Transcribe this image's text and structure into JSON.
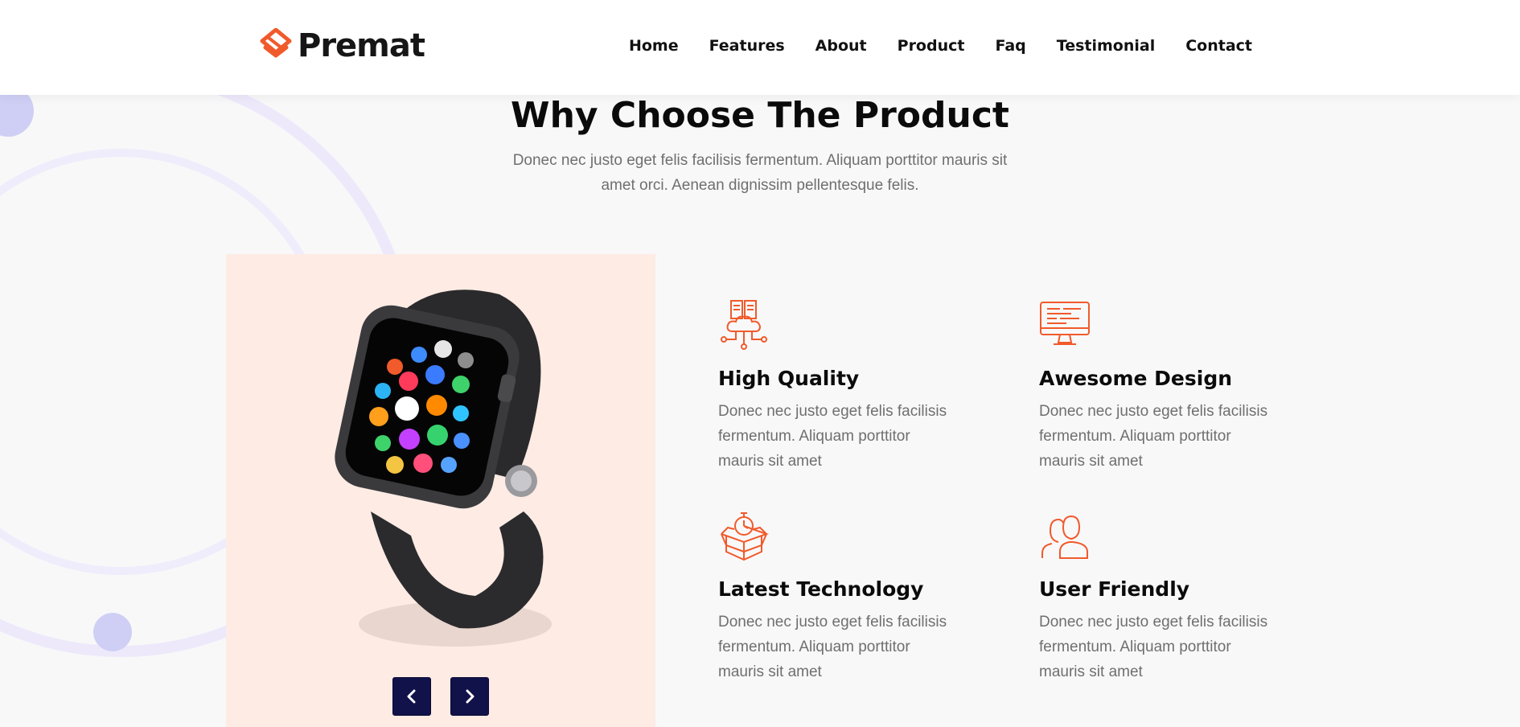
{
  "brand": {
    "name": "Premat",
    "accent": "#f15a2b"
  },
  "nav": {
    "items": [
      {
        "label": "Home"
      },
      {
        "label": "Features"
      },
      {
        "label": "About"
      },
      {
        "label": "Product"
      },
      {
        "label": "Faq"
      },
      {
        "label": "Testimonial"
      },
      {
        "label": "Contact"
      }
    ]
  },
  "section": {
    "title": "Why Choose The Product",
    "subtitle": "Donec nec justo eget felis facilisis fermentum. Aliquam porttitor mauris sit amet orci. Aenean dignissim pellentesque felis."
  },
  "slider": {
    "prev_icon": "chevron-left-icon",
    "next_icon": "chevron-right-icon",
    "button_color": "#12124a"
  },
  "features": [
    {
      "icon": "cloud-server-icon",
      "title": "High Quality",
      "text": "Donec nec justo eget felis facilisis fermentum. Aliquam porttitor mauris sit amet"
    },
    {
      "icon": "monitor-icon",
      "title": "Awesome Design",
      "text": "Donec nec justo eget felis facilisis fermentum. Aliquam porttitor mauris sit amet"
    },
    {
      "icon": "box-timer-icon",
      "title": "Latest Technology",
      "text": "Donec nec justo eget felis facilisis fermentum. Aliquam porttitor mauris sit amet"
    },
    {
      "icon": "users-icon",
      "title": "User Friendly",
      "text": "Donec nec justo eget felis facilisis fermentum. Aliquam porttitor mauris sit amet"
    }
  ]
}
